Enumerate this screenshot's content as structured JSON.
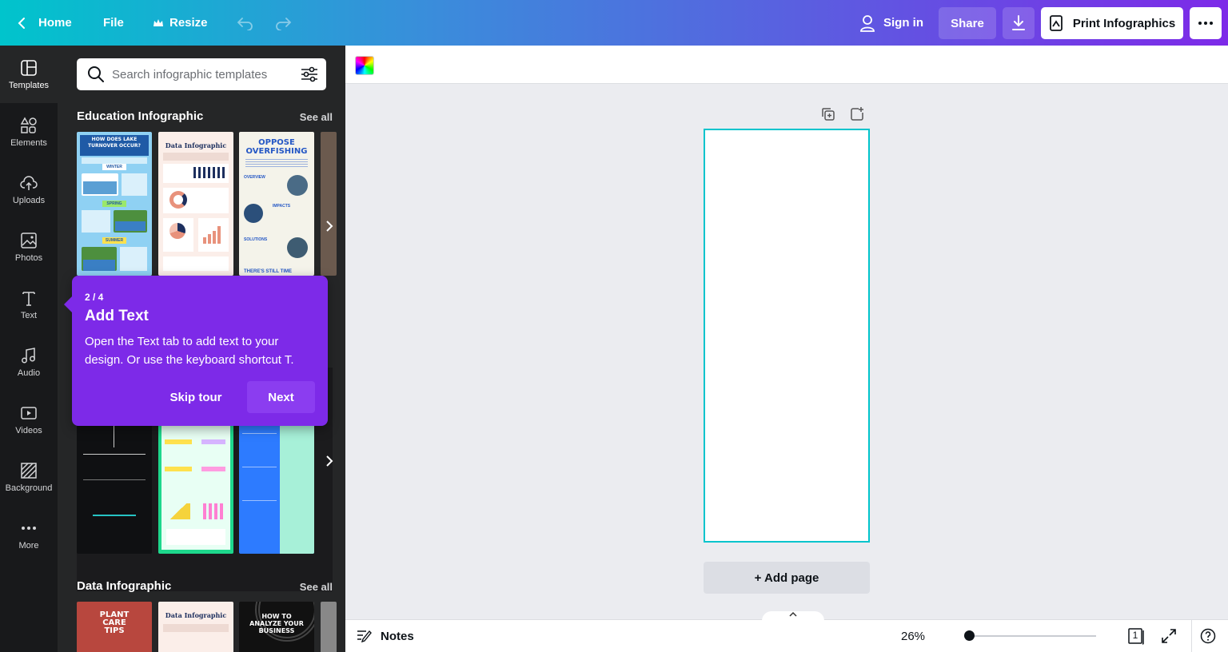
{
  "header": {
    "home_label": "Home",
    "file_label": "File",
    "resize_label": "Resize",
    "signin_label": "Sign in",
    "share_label": "Share",
    "print_label": "Print Infographics"
  },
  "rail": {
    "items": [
      {
        "label": "Templates"
      },
      {
        "label": "Elements"
      },
      {
        "label": "Uploads"
      },
      {
        "label": "Photos"
      },
      {
        "label": "Text"
      },
      {
        "label": "Audio"
      },
      {
        "label": "Videos"
      },
      {
        "label": "Background"
      },
      {
        "label": "More"
      }
    ]
  },
  "panel": {
    "search_placeholder": "Search infographic templates",
    "sections": [
      {
        "title": "Education Infographic",
        "see_all": "See all"
      },
      {
        "title": "Data Infographic",
        "see_all": "See all"
      }
    ],
    "thumbs": {
      "t1": "HOW DOES LAKE TURNOVER OCCUR?",
      "t1_winter": "WINTER",
      "t1_spring": "SPRING",
      "t1_summer": "SUMMER",
      "t2": "Data Infographic",
      "t3": "OPPOSE OVERFISHING",
      "t3_sub1": "OVERVIEW",
      "t3_sub2": "IMPACTS",
      "t3_sub3": "SOLUTIONS",
      "t3_sub4": "THERE'S STILL TIME",
      "d1": "PLANT CARE TIPS",
      "d2": "Data Infographic",
      "d3": "HOW TO ANALYZE YOUR BUSINESS"
    }
  },
  "tour": {
    "step": "2 / 4",
    "title": "Add Text",
    "body": "Open the Text tab to add text to your design. Or use the keyboard shortcut T.",
    "skip_label": "Skip tour",
    "next_label": "Next"
  },
  "canvas": {
    "add_page_label": "+ Add page"
  },
  "footer": {
    "notes_label": "Notes",
    "zoom_label": "26%",
    "zoom_level": 0.26,
    "page_count": "1"
  }
}
